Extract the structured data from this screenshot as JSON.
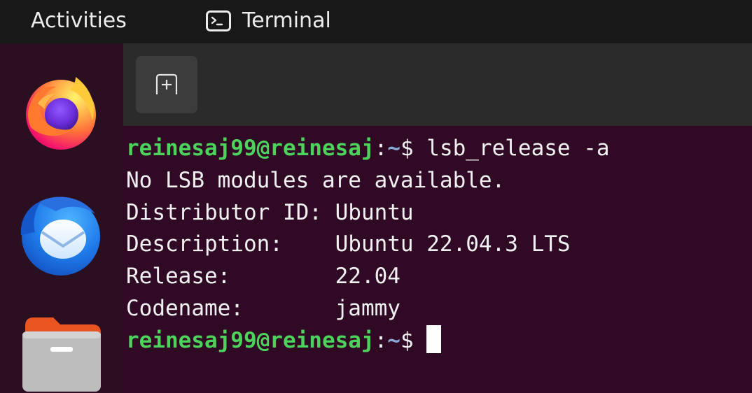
{
  "topbar": {
    "activities_label": "Activities",
    "app_name": "Terminal",
    "app_icon": "terminal-icon"
  },
  "dock": {
    "items": [
      {
        "name": "Firefox",
        "icon": "firefox-icon"
      },
      {
        "name": "Thunderbird",
        "icon": "thunderbird-icon"
      },
      {
        "name": "Files",
        "icon": "files-icon"
      }
    ]
  },
  "terminal": {
    "header": {
      "new_tab_icon": "new-tab-icon"
    },
    "prompt": {
      "user_host": "reinesaj99@reinesaj",
      "colon": ":",
      "path": "~",
      "dollar": "$ "
    },
    "command": "lsb_release -a",
    "output": [
      "No LSB modules are available.",
      "Distributor ID: Ubuntu",
      "Description:    Ubuntu 22.04.3 LTS",
      "Release:        22.04",
      "Codename:       jammy"
    ]
  },
  "colors": {
    "terminal_bg": "#300a24",
    "dock_bg": "#2a0f20",
    "prompt_user": "#4cd35c",
    "prompt_path": "#8aa9d6",
    "topbar_bg": "#181818"
  }
}
